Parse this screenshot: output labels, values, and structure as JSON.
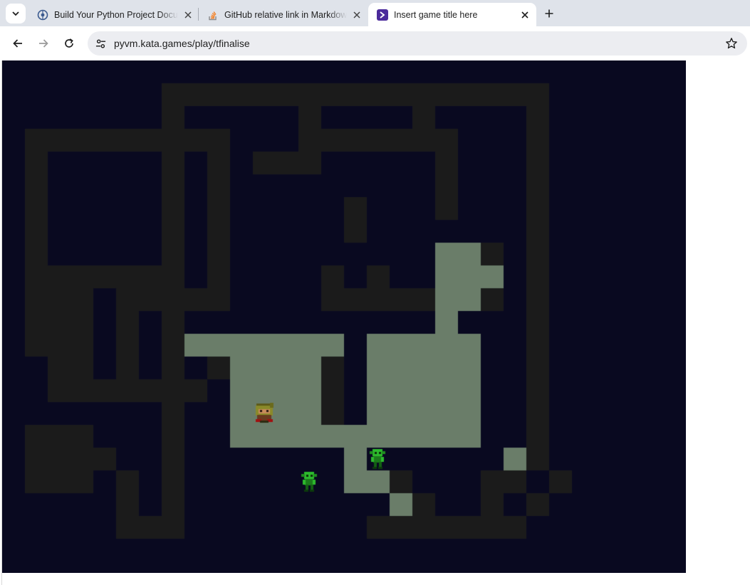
{
  "browser": {
    "tabs": [
      {
        "title": "Build Your Python Project Documentation",
        "icon": "globe-favicon-icon"
      },
      {
        "title": "GitHub relative link in Markdown",
        "icon": "stackoverflow-favicon-icon"
      },
      {
        "title": "Insert game title here",
        "icon": "katagames-favicon-icon",
        "active": true
      }
    ],
    "url": "pyvm.kata.games/play/tfinalise"
  },
  "game": {
    "colors": {
      "void": "#090920",
      "wall": "#1b1b1b",
      "lit_floor": "#6a7d69",
      "hero_body": "#8a8a2a",
      "goblin_green": "#2dbb2d"
    },
    "tile_legend": {
      "0": "void",
      "1": "wall",
      "2": "lit_floor"
    },
    "grid": [
      "..............................",
      ".......#################......",
      ".......#.....#....#....#......",
      ".#########...#######...#......",
      ".#.....#.#.###.....#...#......",
      ".#.....#.#.........#...#......",
      ".#.....#.#.....#...#...#......",
      ".#.....#.#.....#.......#......",
      ".#.....#.#.........==#.#......",
      ".#######.#....#.#..===.#......",
      ".###.#####....#####==#.#......",
      ".###.#.#...........=...#......",
      ".###.#.#:::::::.=====..#......",
      "..##.#.#.#::::#.=====..#......",
      "..#######.::::#.=====..#......",
      ".......#..::::#.=====..#......",
      ".###...#..::::::::::=..#......",
      ".####..#.......=......=#......",
      ".###.#.#.......=:#...##.#.....",
      ".....#.#.........:#..#.#......",
      ".....###........#######......."
    ],
    "hero": {
      "name": "hero",
      "col": 11,
      "row": 15
    },
    "goblins": [
      {
        "name": "goblin-1",
        "col": 16,
        "row": 17
      },
      {
        "name": "goblin-2",
        "col": 13,
        "row": 18
      }
    ]
  }
}
